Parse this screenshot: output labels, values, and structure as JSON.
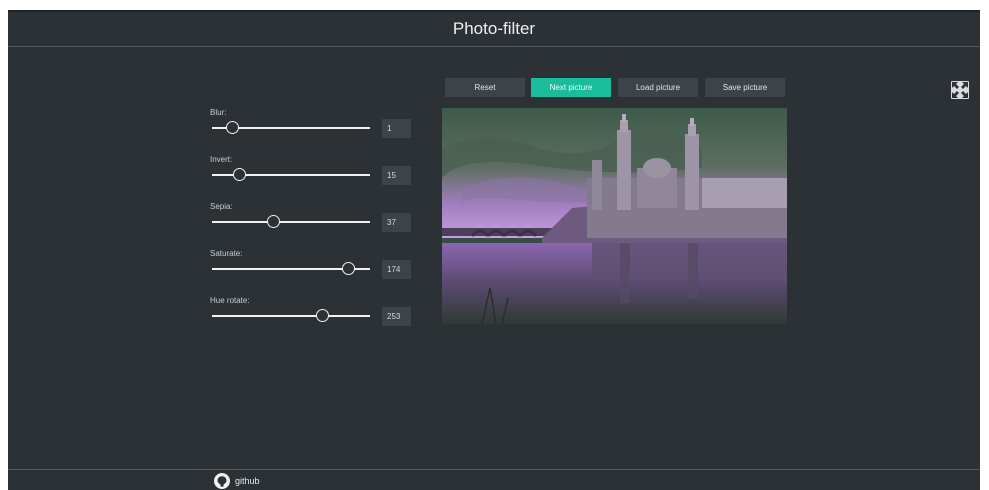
{
  "header": {
    "title": "Photo-filter"
  },
  "toolbar": {
    "buttons": [
      {
        "label": "Reset",
        "active": false
      },
      {
        "label": "Next picture",
        "active": true
      },
      {
        "label": "Load picture",
        "active": false
      },
      {
        "label": "Save picture",
        "active": false
      }
    ]
  },
  "filters": [
    {
      "label": "Blur:",
      "value": "1",
      "level": 0.13
    },
    {
      "label": "Invert:",
      "value": "15",
      "level": 0.18
    },
    {
      "label": "Sepia:",
      "value": "37",
      "level": 0.39
    },
    {
      "label": "Saturate:",
      "value": "174",
      "level": 0.87
    },
    {
      "label": "Hue rotate:",
      "value": "253",
      "level": 0.7
    }
  ],
  "icons": {
    "fullscreen": "fullscreen-icon",
    "github": "github-icon"
  },
  "footer": {
    "link_label": "github"
  },
  "colors": {
    "accent": "#1abc9c",
    "background": "#2c3136",
    "field": "#3d4349"
  }
}
